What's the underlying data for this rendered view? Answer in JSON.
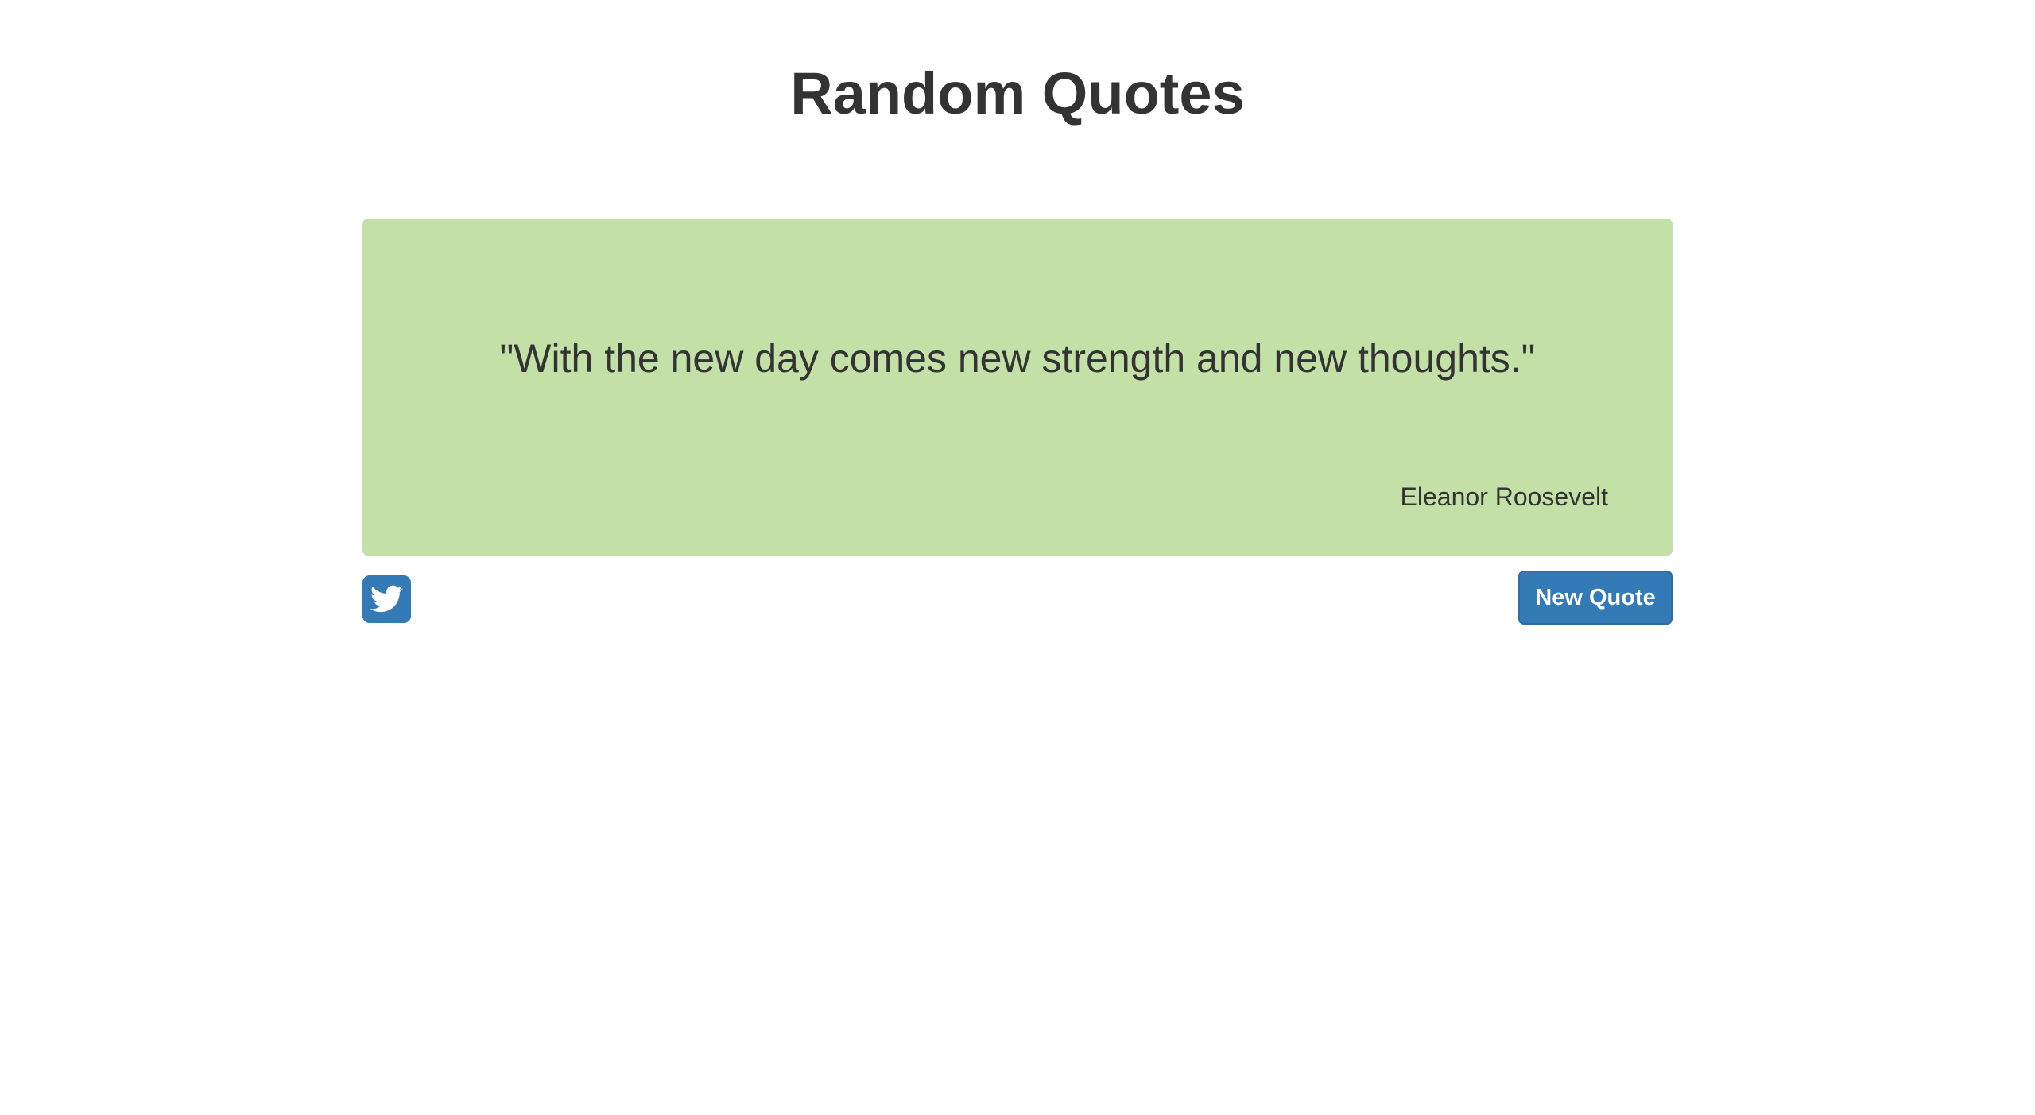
{
  "header": {
    "title": "Random Quotes"
  },
  "quote": {
    "text": "\"With the new day comes new strength and new thoughts.\"",
    "author": "Eleanor Roosevelt",
    "card_color": "#c3e1a7"
  },
  "actions": {
    "tweet_icon": "twitter-icon",
    "new_quote_label": "New Quote",
    "button_color": "#337ab7"
  }
}
